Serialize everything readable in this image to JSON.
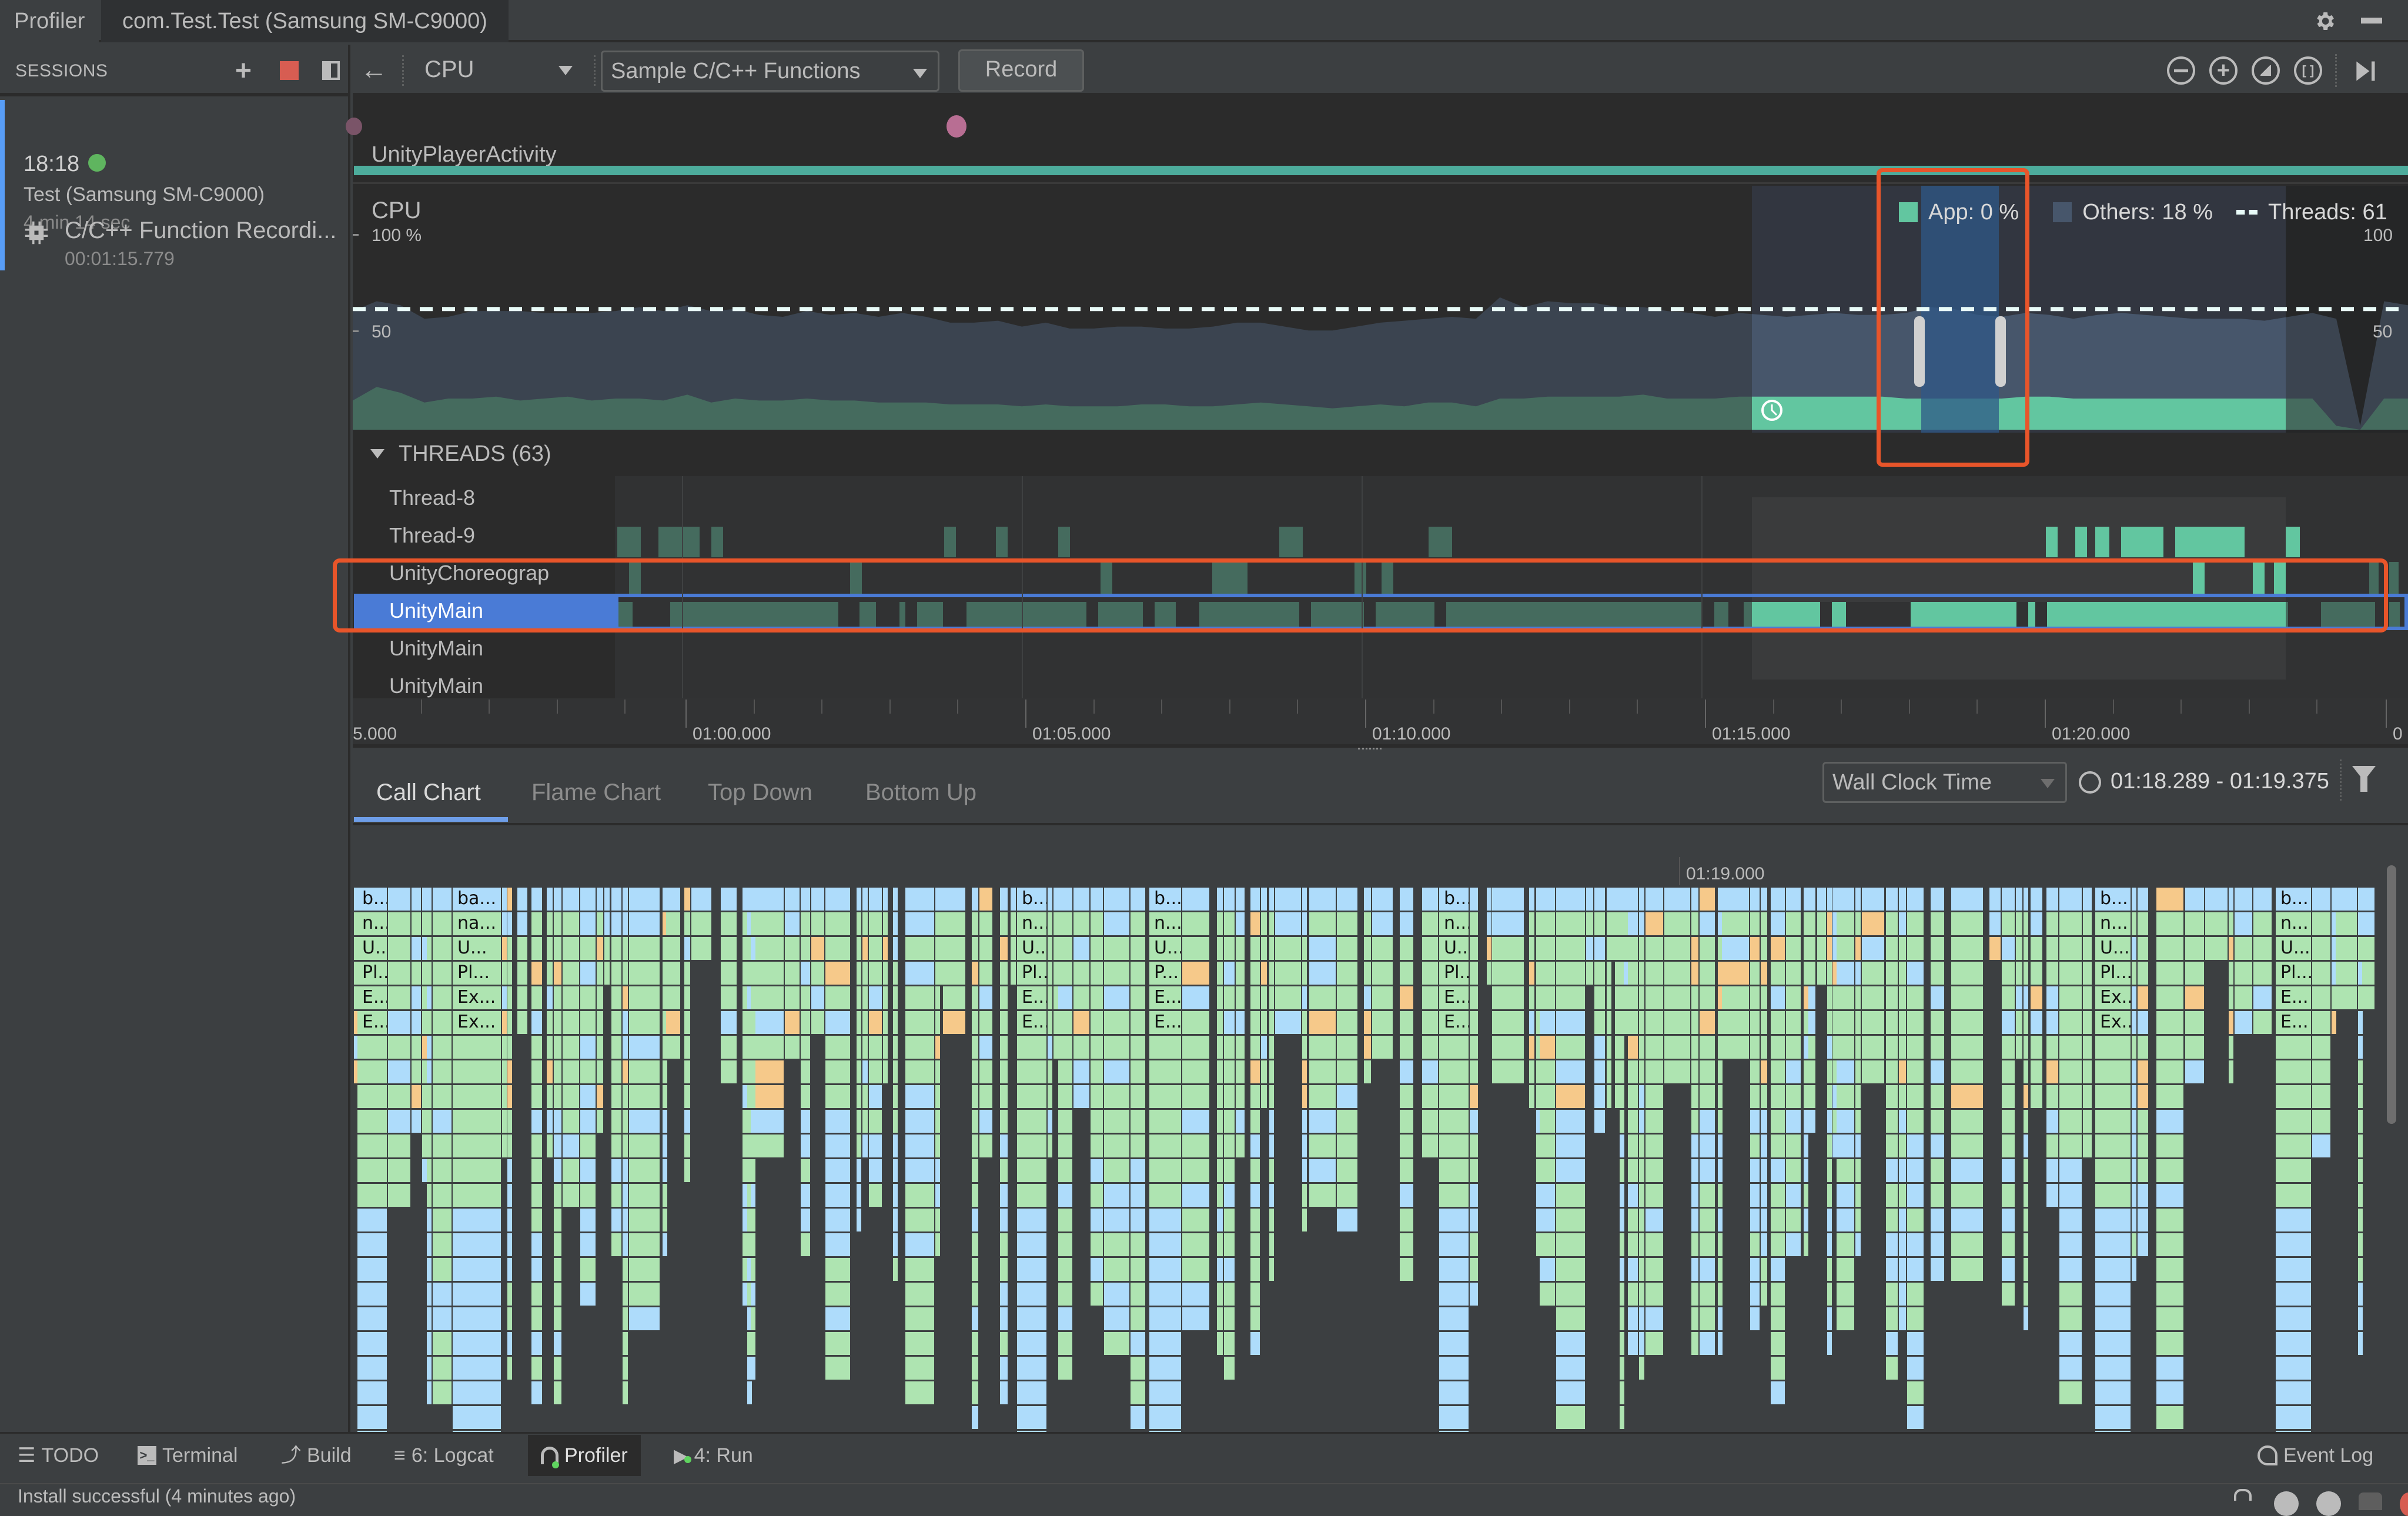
{
  "window": {
    "tabs": [
      {
        "label": "Profiler"
      },
      {
        "label": "com.Test.Test (Samsung SM-C9000)"
      }
    ],
    "settings_icon": "gear-icon",
    "minimize_icon": "minimize-icon"
  },
  "sessions": {
    "header": "SESSIONS",
    "add_icon": "plus-icon",
    "stop_icon": "stop-icon",
    "collapse_icon": "panel-toggle-icon",
    "session": {
      "time": "18:18",
      "status_color": "#5fb55f",
      "name": "Test (Samsung SM-C9000)",
      "duration": "4 min 14 sec",
      "recording": {
        "label": "C/C++ Function Recordi...",
        "time": "00:01:15.779",
        "icon": "chip-icon"
      }
    }
  },
  "toolbar": {
    "back_icon": "back-arrow-icon",
    "profiler_select": "CPU",
    "config_select": "Sample C/C++ Functions",
    "record_label": "Record",
    "zoom_out_icon": "zoom-out-icon",
    "zoom_in_icon": "zoom-in-icon",
    "reset_zoom_icon": "reset-zoom-icon",
    "zoom_to_selection_icon": "zoom-to-selection-icon",
    "go_live_icon": "go-live-icon"
  },
  "events": {
    "activity_label": "UnityPlayerActivity",
    "activity_color": "#4dac9c",
    "event_marker_color": "#b86e93"
  },
  "cpu": {
    "title": "CPU",
    "axis_left": {
      "top": "100 %",
      "mid": "50"
    },
    "axis_right": {
      "top": "100",
      "mid": "50"
    },
    "legend": {
      "app": "App: 0 %",
      "others": "Others: 18 %",
      "threads": "Threads: 61"
    },
    "colors": {
      "app": "#62c6a0",
      "others": "#47566b",
      "threads_line": "#e8fbf8",
      "selection": "#2f5887"
    },
    "threads_count_pct": 62,
    "app_series": [
      15,
      22,
      19,
      14,
      16,
      16,
      17,
      15,
      16,
      17,
      15,
      16,
      16,
      15,
      18,
      14,
      16,
      15,
      15,
      16,
      15,
      15,
      14,
      14,
      14,
      13,
      13,
      13,
      12,
      13,
      12,
      12,
      12,
      13,
      13,
      12,
      12,
      13,
      14,
      13,
      12,
      11,
      12,
      13,
      12,
      14,
      14,
      12,
      16,
      16,
      17,
      17,
      17,
      17,
      18,
      16,
      16,
      16,
      17,
      17,
      17,
      17,
      17,
      17,
      17,
      16,
      16,
      16,
      16,
      16,
      17,
      17,
      16,
      16,
      16,
      16,
      16,
      16,
      16,
      16,
      16,
      16,
      16,
      2,
      0,
      16,
      16
    ],
    "others_series": [
      46,
      44,
      45,
      43,
      42,
      45,
      44,
      46,
      44,
      43,
      45,
      45,
      47,
      46,
      46,
      47,
      46,
      44,
      43,
      45,
      44,
      45,
      44,
      46,
      44,
      42,
      42,
      43,
      41,
      42,
      40,
      40,
      41,
      40,
      39,
      40,
      41,
      42,
      41,
      40,
      39,
      40,
      41,
      42,
      44,
      43,
      44,
      45,
      52,
      47,
      49,
      48,
      48,
      46,
      45,
      45,
      44,
      42,
      43,
      42,
      41,
      42,
      43,
      42,
      42,
      44,
      47,
      46,
      43,
      42,
      43,
      42,
      41,
      43,
      44,
      43,
      42,
      41,
      41,
      41,
      40,
      42,
      44,
      55,
      2,
      50,
      48
    ]
  },
  "threads": {
    "header": "THREADS (63)",
    "rows": [
      {
        "name": "Thread-8"
      },
      {
        "name": "Thread-9"
      },
      {
        "name": "UnityChoreograp"
      },
      {
        "name": "UnityMain",
        "selected": true
      },
      {
        "name": "UnityMain"
      },
      {
        "name": "UnityMain"
      }
    ],
    "axis_ticks": [
      "5.000",
      "01:00.000",
      "01:05.000",
      "01:10.000",
      "01:15.000",
      "01:20.000",
      "0"
    ]
  },
  "detail": {
    "tabs": [
      {
        "label": "Call Chart",
        "active": true
      },
      {
        "label": "Flame Chart"
      },
      {
        "label": "Top Down"
      },
      {
        "label": "Bottom Up"
      }
    ],
    "clock_select": "Wall Clock Time",
    "range": "01:18.289 - 01:19.375",
    "clock_icon": "clock-icon",
    "filter_icon": "filter-icon",
    "chart_tick": "01:19.000",
    "colors": {
      "native": "#aedcfb",
      "app": "#aee4b1",
      "system": "#f6c98a",
      "gap": "#3c3f41"
    },
    "labels": [
      [
        "b...",
        "n...",
        "U...",
        "Pl...",
        "E...",
        "E..."
      ],
      [
        "ba...",
        "na...",
        "U...",
        "Pl...",
        "Ex...",
        "Ex..."
      ],
      [
        "b...",
        "n...",
        "U...",
        "",
        "",
        ""
      ],
      [
        "b...",
        "n...",
        "",
        "P...",
        "E...",
        "E..."
      ],
      [
        "b...",
        "n...",
        "U...",
        "Pl...",
        "E...",
        "E..."
      ],
      [
        "b...",
        "n...",
        "U...",
        "P...",
        "E...",
        "E..."
      ],
      [
        "b...",
        "n...",
        "U...",
        "Pl...",
        "Ex...",
        "Ex..."
      ],
      [
        "b...",
        "n...",
        "U...",
        "Pl...",
        "E...",
        "E..."
      ],
      [
        "b...",
        "n...",
        "U...",
        "Pl...",
        "Ex...",
        "Ex..."
      ],
      [
        "b...",
        "n...",
        "U...",
        "Pl...",
        "E...",
        "E..."
      ]
    ]
  },
  "bottom": {
    "tools": [
      {
        "label": "TODO",
        "icon": "list-icon"
      },
      {
        "label": "Terminal",
        "icon": "terminal-icon"
      },
      {
        "label": "Build",
        "icon": "hammer-icon"
      },
      {
        "label": "6: Logcat",
        "icon": "logcat-icon"
      },
      {
        "label": "Profiler",
        "icon": "profiler-gauge-icon",
        "active": true
      },
      {
        "label": "4: Run",
        "icon": "run-icon"
      }
    ],
    "event_log": "Event Log",
    "status": "Install successful (4 minutes ago)"
  }
}
